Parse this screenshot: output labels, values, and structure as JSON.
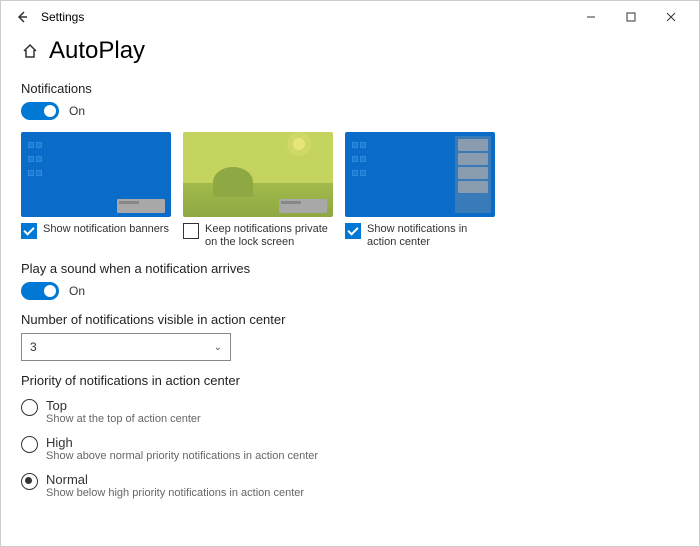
{
  "window": {
    "title": "Settings"
  },
  "page": {
    "title": "AutoPlay"
  },
  "notifications": {
    "heading": "Notifications",
    "toggle_label": "On",
    "opt_banner": "Show notification banners",
    "opt_lock": "Keep notifications private on the lock screen",
    "opt_ac": "Show notifications in action center"
  },
  "sound": {
    "heading": "Play a sound when a notification arrives",
    "toggle_label": "On"
  },
  "count": {
    "heading": "Number of notifications visible in action center",
    "value": "3"
  },
  "priority": {
    "heading": "Priority of notifications in action center",
    "opt1_label": "Top",
    "opt1_desc": "Show at the top of action center",
    "opt2_label": "High",
    "opt2_desc": "Show above normal priority notifications in action center",
    "opt3_label": "Normal",
    "opt3_desc": "Show below high priority notifications in action center"
  }
}
